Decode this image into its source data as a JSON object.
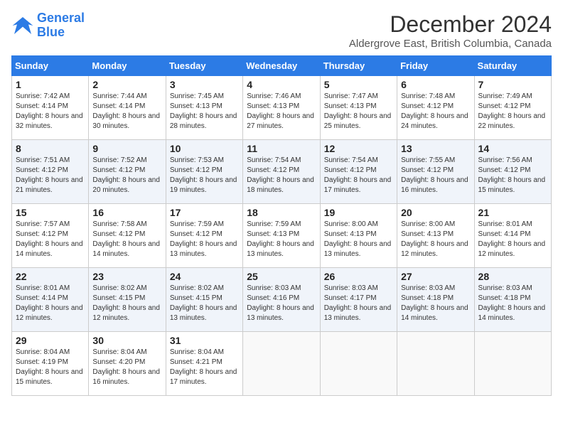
{
  "header": {
    "logo_line1": "General",
    "logo_line2": "Blue",
    "month_title": "December 2024",
    "location": "Aldergrove East, British Columbia, Canada"
  },
  "days_of_week": [
    "Sunday",
    "Monday",
    "Tuesday",
    "Wednesday",
    "Thursday",
    "Friday",
    "Saturday"
  ],
  "weeks": [
    [
      {
        "day": "1",
        "sunrise": "7:42 AM",
        "sunset": "4:14 PM",
        "daylight": "8 hours and 32 minutes."
      },
      {
        "day": "2",
        "sunrise": "7:44 AM",
        "sunset": "4:14 PM",
        "daylight": "8 hours and 30 minutes."
      },
      {
        "day": "3",
        "sunrise": "7:45 AM",
        "sunset": "4:13 PM",
        "daylight": "8 hours and 28 minutes."
      },
      {
        "day": "4",
        "sunrise": "7:46 AM",
        "sunset": "4:13 PM",
        "daylight": "8 hours and 27 minutes."
      },
      {
        "day": "5",
        "sunrise": "7:47 AM",
        "sunset": "4:13 PM",
        "daylight": "8 hours and 25 minutes."
      },
      {
        "day": "6",
        "sunrise": "7:48 AM",
        "sunset": "4:12 PM",
        "daylight": "8 hours and 24 minutes."
      },
      {
        "day": "7",
        "sunrise": "7:49 AM",
        "sunset": "4:12 PM",
        "daylight": "8 hours and 22 minutes."
      }
    ],
    [
      {
        "day": "8",
        "sunrise": "7:51 AM",
        "sunset": "4:12 PM",
        "daylight": "8 hours and 21 minutes."
      },
      {
        "day": "9",
        "sunrise": "7:52 AM",
        "sunset": "4:12 PM",
        "daylight": "8 hours and 20 minutes."
      },
      {
        "day": "10",
        "sunrise": "7:53 AM",
        "sunset": "4:12 PM",
        "daylight": "8 hours and 19 minutes."
      },
      {
        "day": "11",
        "sunrise": "7:54 AM",
        "sunset": "4:12 PM",
        "daylight": "8 hours and 18 minutes."
      },
      {
        "day": "12",
        "sunrise": "7:54 AM",
        "sunset": "4:12 PM",
        "daylight": "8 hours and 17 minutes."
      },
      {
        "day": "13",
        "sunrise": "7:55 AM",
        "sunset": "4:12 PM",
        "daylight": "8 hours and 16 minutes."
      },
      {
        "day": "14",
        "sunrise": "7:56 AM",
        "sunset": "4:12 PM",
        "daylight": "8 hours and 15 minutes."
      }
    ],
    [
      {
        "day": "15",
        "sunrise": "7:57 AM",
        "sunset": "4:12 PM",
        "daylight": "8 hours and 14 minutes."
      },
      {
        "day": "16",
        "sunrise": "7:58 AM",
        "sunset": "4:12 PM",
        "daylight": "8 hours and 14 minutes."
      },
      {
        "day": "17",
        "sunrise": "7:59 AM",
        "sunset": "4:12 PM",
        "daylight": "8 hours and 13 minutes."
      },
      {
        "day": "18",
        "sunrise": "7:59 AM",
        "sunset": "4:13 PM",
        "daylight": "8 hours and 13 minutes."
      },
      {
        "day": "19",
        "sunrise": "8:00 AM",
        "sunset": "4:13 PM",
        "daylight": "8 hours and 13 minutes."
      },
      {
        "day": "20",
        "sunrise": "8:00 AM",
        "sunset": "4:13 PM",
        "daylight": "8 hours and 12 minutes."
      },
      {
        "day": "21",
        "sunrise": "8:01 AM",
        "sunset": "4:14 PM",
        "daylight": "8 hours and 12 minutes."
      }
    ],
    [
      {
        "day": "22",
        "sunrise": "8:01 AM",
        "sunset": "4:14 PM",
        "daylight": "8 hours and 12 minutes."
      },
      {
        "day": "23",
        "sunrise": "8:02 AM",
        "sunset": "4:15 PM",
        "daylight": "8 hours and 12 minutes."
      },
      {
        "day": "24",
        "sunrise": "8:02 AM",
        "sunset": "4:15 PM",
        "daylight": "8 hours and 13 minutes."
      },
      {
        "day": "25",
        "sunrise": "8:03 AM",
        "sunset": "4:16 PM",
        "daylight": "8 hours and 13 minutes."
      },
      {
        "day": "26",
        "sunrise": "8:03 AM",
        "sunset": "4:17 PM",
        "daylight": "8 hours and 13 minutes."
      },
      {
        "day": "27",
        "sunrise": "8:03 AM",
        "sunset": "4:18 PM",
        "daylight": "8 hours and 14 minutes."
      },
      {
        "day": "28",
        "sunrise": "8:03 AM",
        "sunset": "4:18 PM",
        "daylight": "8 hours and 14 minutes."
      }
    ],
    [
      {
        "day": "29",
        "sunrise": "8:04 AM",
        "sunset": "4:19 PM",
        "daylight": "8 hours and 15 minutes."
      },
      {
        "day": "30",
        "sunrise": "8:04 AM",
        "sunset": "4:20 PM",
        "daylight": "8 hours and 16 minutes."
      },
      {
        "day": "31",
        "sunrise": "8:04 AM",
        "sunset": "4:21 PM",
        "daylight": "8 hours and 17 minutes."
      },
      null,
      null,
      null,
      null
    ]
  ]
}
